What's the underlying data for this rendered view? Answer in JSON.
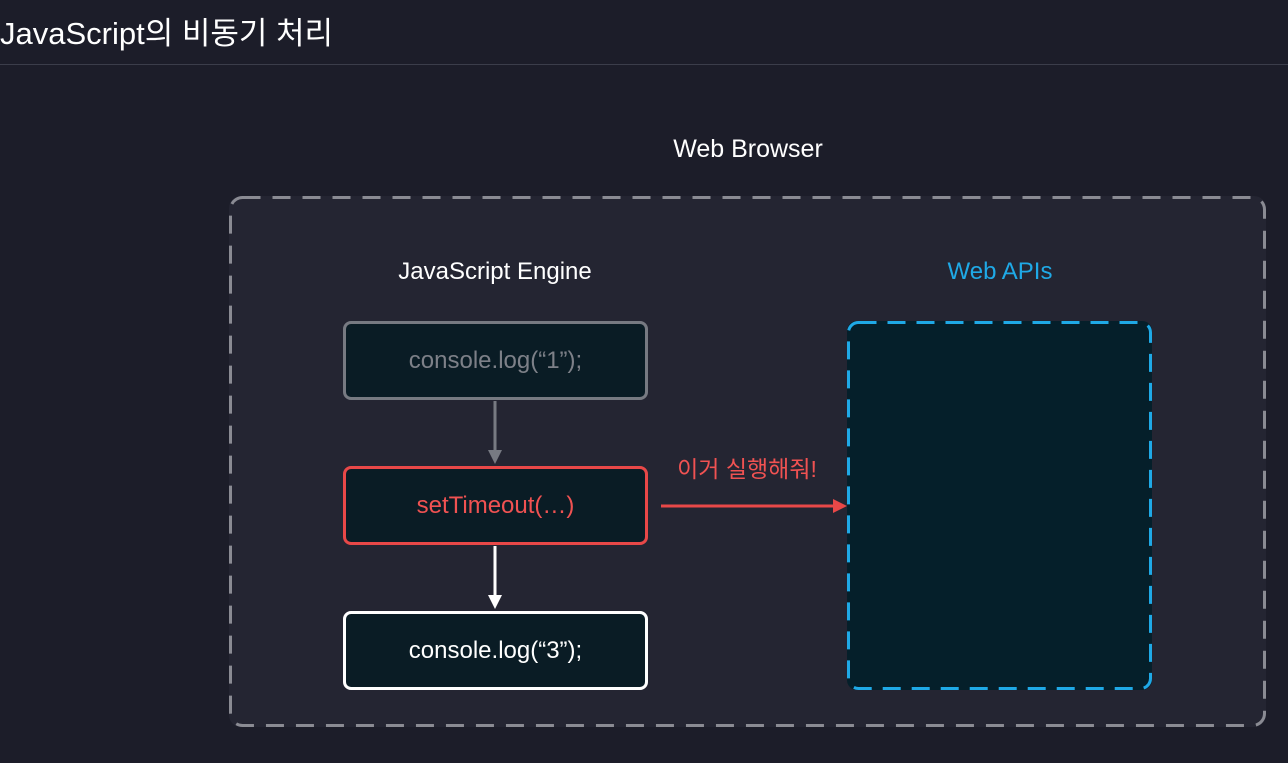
{
  "page": {
    "title": "JavaScript의 비동기 처리"
  },
  "diagram": {
    "browser_label": "Web Browser",
    "engine_label": "JavaScript Engine",
    "apis_label": "Web APIs",
    "code_boxes": [
      {
        "text": "console.log(“1”);",
        "state": "done"
      },
      {
        "text": "setTimeout(…)",
        "state": "active"
      },
      {
        "text": "console.log(“3”);",
        "state": "next"
      }
    ],
    "request_label": "이거 실행해줘!"
  },
  "colors": {
    "background": "#1c1d29",
    "browser_fill": "#242532",
    "dashed_border": "#8a8b93",
    "apis_accent": "#1fa9e6",
    "active_red": "#f05252",
    "done_gray": "#7d8088",
    "code_fill": "#0a1c25"
  }
}
